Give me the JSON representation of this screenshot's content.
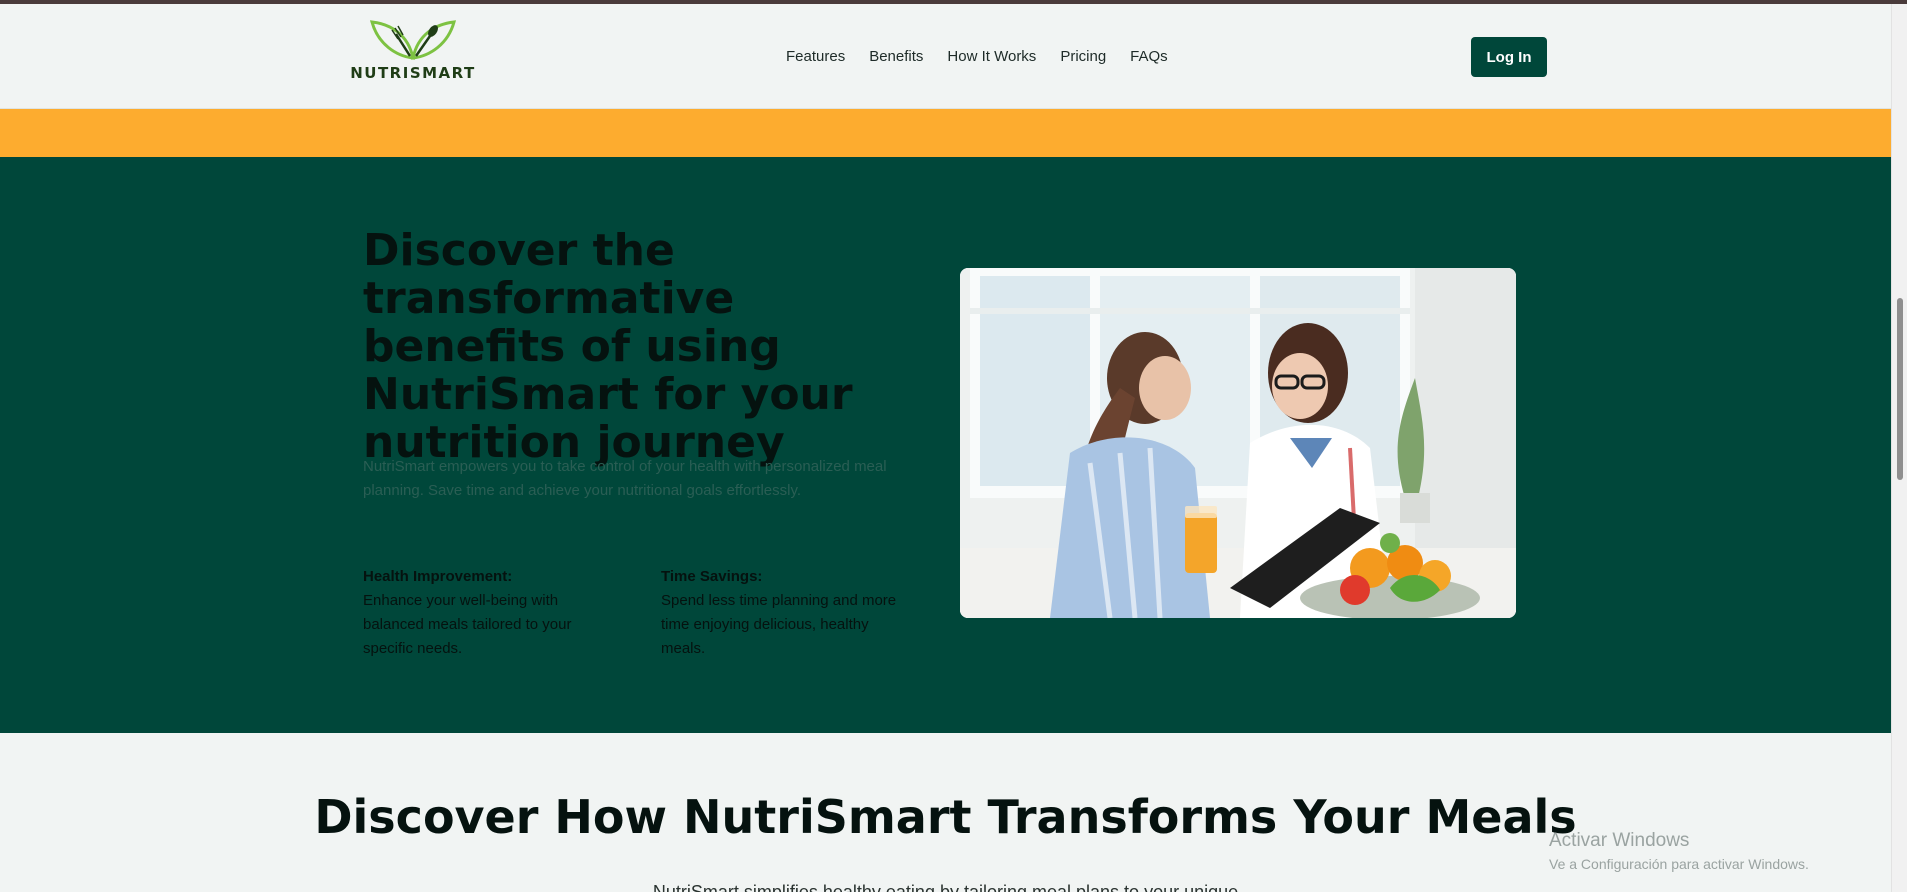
{
  "header": {
    "logo_text": "NUTRISMART",
    "nav": [
      "Features",
      "Benefits",
      "How It Works",
      "Pricing",
      "FAQs"
    ],
    "login_label": "Log In"
  },
  "hero": {
    "heading": "Discover the transformative benefits of using NutriSmart for your nutrition journey",
    "lead": "NutriSmart empowers you to take control of your health with personalized meal planning. Save time and achieve your nutritional goals effortlessly.",
    "benefits": [
      {
        "title": "Health Improvement:",
        "text": "Enhance your well-being with balanced meals tailored to your specific needs."
      },
      {
        "title": "Time Savings:",
        "text": "Spend less time planning and more time enjoying delicious, healthy meals."
      }
    ]
  },
  "next_section": {
    "title": "Discover How NutriSmart Transforms Your Meals",
    "subtitle": "NutriSmart simplifies healthy eating by tailoring meal plans to your unique"
  },
  "watermark": {
    "line1": "Activar Windows",
    "line2": "Ve a Configuración para activar Windows."
  },
  "colors": {
    "brand_green": "#00473a",
    "accent_orange": "#fdac2f",
    "page_bg": "#f1f4f3",
    "logo_leaf": "#7dc242",
    "logo_text": "#1f3d16"
  },
  "icons": [
    "logo-leaf-icon",
    "fork-icon",
    "spoon-icon"
  ]
}
